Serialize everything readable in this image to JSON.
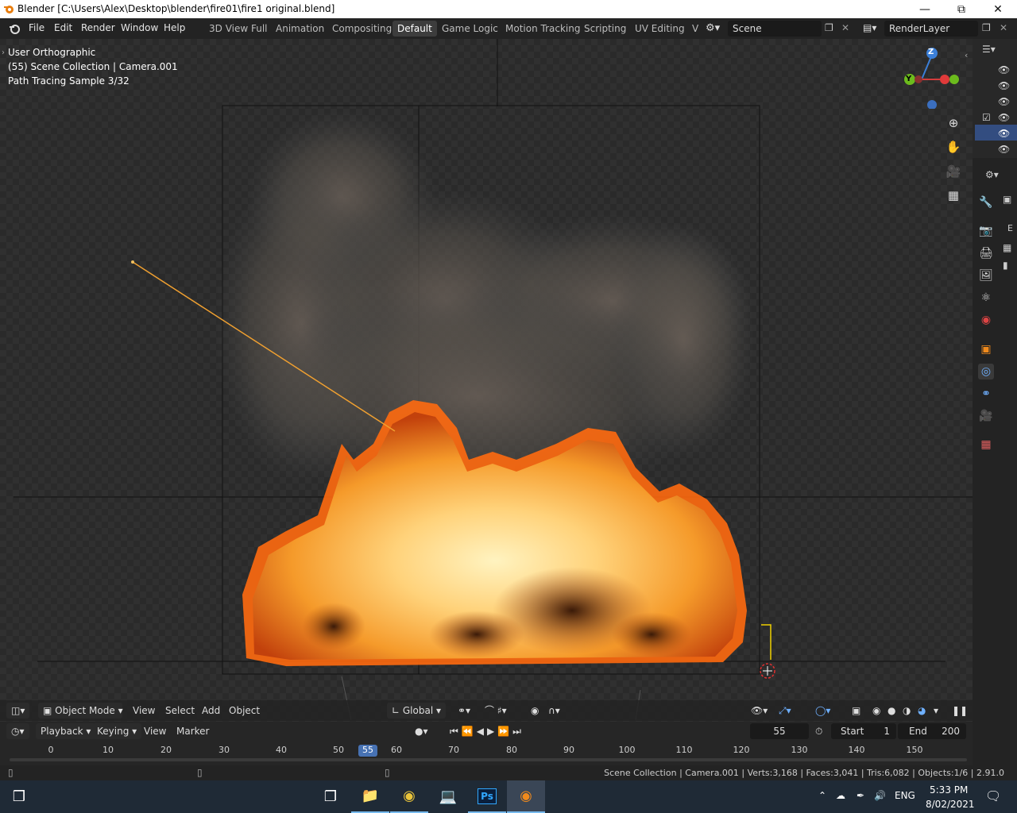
{
  "window": {
    "title": "Blender [C:\\Users\\Alex\\Desktop\\blender\\fire01\\fire1 original.blend]"
  },
  "menu": [
    "File",
    "Edit",
    "Render",
    "Window",
    "Help"
  ],
  "workspaces": [
    "3D View Full",
    "Animation",
    "Compositing",
    "Default",
    "Game Logic",
    "Motion Tracking",
    "Scripting",
    "UV Editing",
    "V"
  ],
  "active_workspace": "Default",
  "scene": {
    "name": "Scene",
    "render_layer": "RenderLayer"
  },
  "viewport": {
    "view_name": "User Orthographic",
    "collection_info": "(55) Scene Collection | Camera.001",
    "render_status": "Path Tracing Sample 3/32",
    "gizmo": {
      "z": "Z",
      "y": "Y"
    }
  },
  "viewport_header": {
    "mode": "Object Mode",
    "menus": [
      "View",
      "Select",
      "Add",
      "Object"
    ],
    "orientation": "Global"
  },
  "timeline": {
    "menus": [
      "Playback",
      "Keying",
      "View",
      "Marker"
    ],
    "current_frame": "55",
    "start_label": "Start",
    "start": "1",
    "end_label": "End",
    "end": "200",
    "ruler": [
      "0",
      "10",
      "20",
      "30",
      "40",
      "50",
      "60",
      "70",
      "80",
      "90",
      "100",
      "110",
      "120",
      "130",
      "140",
      "150"
    ]
  },
  "status_bar": {
    "stats": "Scene Collection | Camera.001 | Verts:3,168 | Faces:3,041 | Tris:6,082 | Objects:1/6 | 2.91.0"
  },
  "properties": {
    "tab_letter": "E"
  },
  "taskbar": {
    "language": "ENG",
    "time": "5:33 PM",
    "date": "8/02/2021"
  }
}
